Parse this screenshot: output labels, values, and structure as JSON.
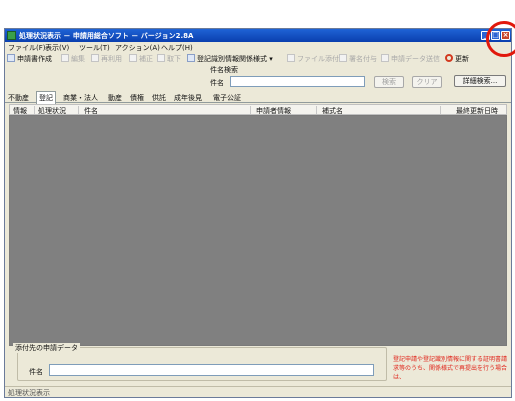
{
  "window": {
    "title": "処理状況表示 － 申請用総合ソフト － バージョン2.8A",
    "controls": {
      "minimize": "_",
      "maximize": "□",
      "close": "×"
    }
  },
  "menu": [
    "ファイル(F)",
    "表示(V)",
    "ツール(T)",
    "アクション(A)",
    "ヘルプ(H)"
  ],
  "toolbar": {
    "create": "申請書作成",
    "edit": "編集",
    "reuse": "再利用",
    "amend": "補正",
    "withdraw": "取下",
    "register_cert": "登記識別情報関係様式 ▾",
    "attach_file": "ファイル添付",
    "sign": "署名付与",
    "send_data": "申請データ送信",
    "refresh": "更新"
  },
  "search": {
    "group_label": "件名検索",
    "field_label": "件名",
    "value": "",
    "search_button": "検索",
    "clear_button": "クリア",
    "detail_button": "詳細検索..."
  },
  "tabs": [
    "不動産",
    "登記",
    "商業・法人",
    "動産",
    "債権",
    "供託",
    "成年後見",
    "電子公証"
  ],
  "grid": {
    "columns": [
      "情報",
      "処理状況",
      "件名",
      "申請者情報",
      "補式名",
      "最終更新日時"
    ]
  },
  "attachment": {
    "group_label": "添付先の申請データ",
    "field_label": "件名",
    "value": ""
  },
  "notice": "登記申請や登記識別情報に関する証明書請求等のうち、関係様式で再提出を行う場合は、",
  "status": "処理状況表示"
}
